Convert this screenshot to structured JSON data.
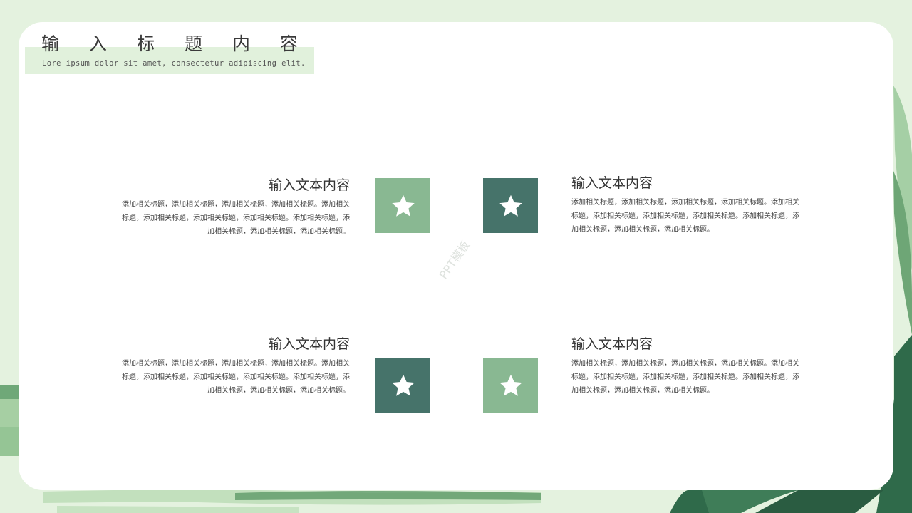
{
  "header": {
    "title": "输入标题内容",
    "subtitle": "Lore ipsum dolor sit amet, consectetur adipiscing elit."
  },
  "watermark": "PPT模板",
  "items": [
    {
      "heading": "输入文本内容",
      "body": "添加相关标题，添加相关标题，添加相关标题，添加相关标题。添加相关标题，添加相关标题，添加相关标题，添加相关标题。添加相关标题，添加相关标题，添加相关标题，添加相关标题。"
    },
    {
      "heading": "输入文本内容",
      "body": "添加相关标题，添加相关标题，添加相关标题，添加相关标题。添加相关标题，添加相关标题，添加相关标题，添加相关标题。添加相关标题，添加相关标题，添加相关标题，添加相关标题。"
    },
    {
      "heading": "输入文本内容",
      "body": "添加相关标题，添加相关标题，添加相关标题，添加相关标题。添加相关标题，添加相关标题，添加相关标题，添加相关标题。添加相关标题，添加相关标题，添加相关标题，添加相关标题。"
    },
    {
      "heading": "输入文本内容",
      "body": "添加相关标题，添加相关标题，添加相关标题，添加相关标题。添加相关标题，添加相关标题，添加相关标题，添加相关标题。添加相关标题，添加相关标题，添加相关标题，添加相关标题。"
    }
  ],
  "tiles": [
    {
      "icon": "star-icon",
      "color": "#89b892"
    },
    {
      "icon": "star-icon",
      "color": "#46736a"
    },
    {
      "icon": "star-icon",
      "color": "#46736a"
    },
    {
      "icon": "star-icon",
      "color": "#89b892"
    }
  ],
  "colors": {
    "background": "#e4f2df",
    "accent_light": "#89b892",
    "accent_dark": "#46736a",
    "leaf_green": "#2f6a4a"
  }
}
